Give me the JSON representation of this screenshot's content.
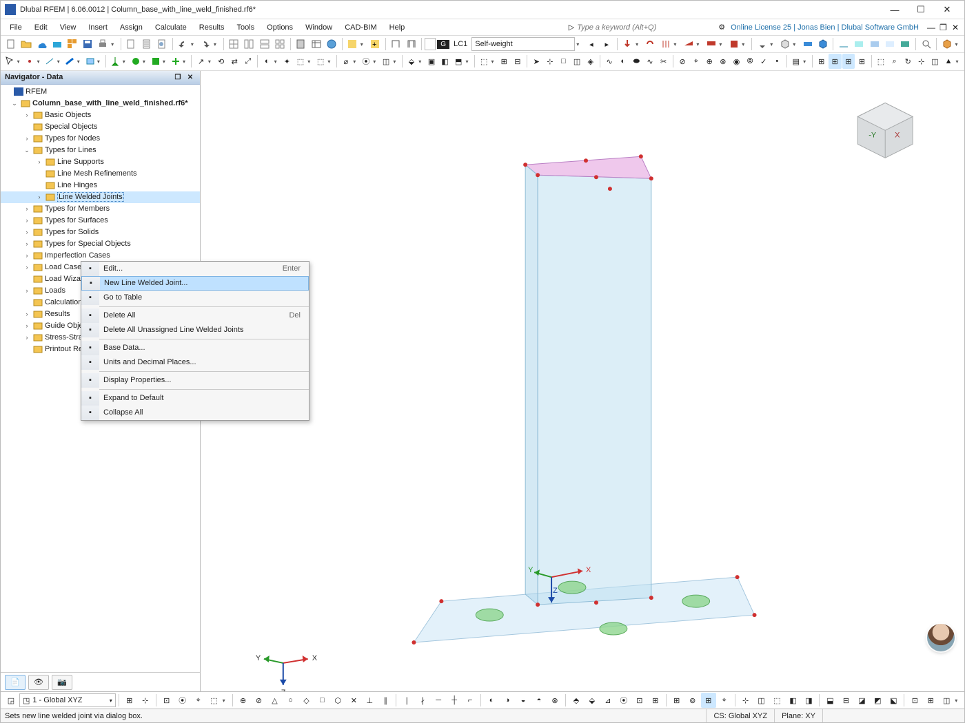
{
  "window": {
    "title": "Dlubal RFEM | 6.06.0012 | Column_base_with_line_weld_finished.rf6*"
  },
  "menu": {
    "items": [
      "File",
      "Edit",
      "View",
      "Insert",
      "Assign",
      "Calculate",
      "Results",
      "Tools",
      "Options",
      "Window",
      "CAD-BIM",
      "Help"
    ],
    "keyword_placeholder": "Type a keyword (Alt+Q)",
    "license": "Online License 25 | Jonas Bien | Dlubal Software GmbH"
  },
  "loadcase": {
    "badge": "G",
    "id": "LC1",
    "name": "Self-weight"
  },
  "navigator": {
    "title": "Navigator - Data",
    "root": "RFEM",
    "model": "Column_base_with_line_weld_finished.rf6*",
    "items": [
      {
        "label": "Basic Objects",
        "level": 2,
        "tw": ">"
      },
      {
        "label": "Special Objects",
        "level": 2,
        "tw": ""
      },
      {
        "label": "Types for Nodes",
        "level": 2,
        "tw": ">"
      },
      {
        "label": "Types for Lines",
        "level": 2,
        "tw": "v"
      },
      {
        "label": "Line Supports",
        "level": 3,
        "tw": ">"
      },
      {
        "label": "Line Mesh Refinements",
        "level": 3,
        "tw": ""
      },
      {
        "label": "Line Hinges",
        "level": 3,
        "tw": ""
      },
      {
        "label": "Line Welded Joints",
        "level": 3,
        "tw": ">",
        "selected": true
      },
      {
        "label": "Types for Members",
        "level": 2,
        "tw": ">"
      },
      {
        "label": "Types for Surfaces",
        "level": 2,
        "tw": ">"
      },
      {
        "label": "Types for Solids",
        "level": 2,
        "tw": ">"
      },
      {
        "label": "Types for Special Objects",
        "level": 2,
        "tw": ">"
      },
      {
        "label": "Imperfection Cases",
        "level": 2,
        "tw": ">"
      },
      {
        "label": "Load Cases and Combinations",
        "level": 2,
        "tw": ">"
      },
      {
        "label": "Load Wizards",
        "level": 2,
        "tw": ""
      },
      {
        "label": "Loads",
        "level": 2,
        "tw": ">"
      },
      {
        "label": "Calculation Diagrams",
        "level": 2,
        "tw": ""
      },
      {
        "label": "Results",
        "level": 2,
        "tw": ">"
      },
      {
        "label": "Guide Objects",
        "level": 2,
        "tw": ">"
      },
      {
        "label": "Stress-Strain Analysis",
        "level": 2,
        "tw": ">"
      },
      {
        "label": "Printout Reports",
        "level": 2,
        "tw": ""
      }
    ]
  },
  "context_menu": {
    "items": [
      {
        "label": "Edit...",
        "hotkey": "Enter",
        "sep": false
      },
      {
        "label": "New Line Welded Joint...",
        "hover": true,
        "sep": false
      },
      {
        "label": "Go to Table",
        "sep": true
      },
      {
        "label": "Delete All",
        "hotkey": "Del",
        "sep": false
      },
      {
        "label": "Delete All Unassigned Line Welded Joints",
        "disabled": true,
        "sep": true
      },
      {
        "label": "Base Data...",
        "sep": false
      },
      {
        "label": "Units and Decimal Places...",
        "sep": true
      },
      {
        "label": "Display Properties...",
        "sep": true
      },
      {
        "label": "Expand to Default",
        "sep": false
      },
      {
        "label": "Collapse All",
        "sep": false
      }
    ]
  },
  "workplane": "1 - Global XYZ",
  "status": {
    "hint": "Sets new line welded joint via dialog box.",
    "cs": "CS: Global XYZ",
    "plane": "Plane: XY"
  },
  "axes": {
    "x": "X",
    "y": "Y",
    "z": "Z"
  },
  "navcube": {
    "y": "-Y",
    "x": "X"
  }
}
